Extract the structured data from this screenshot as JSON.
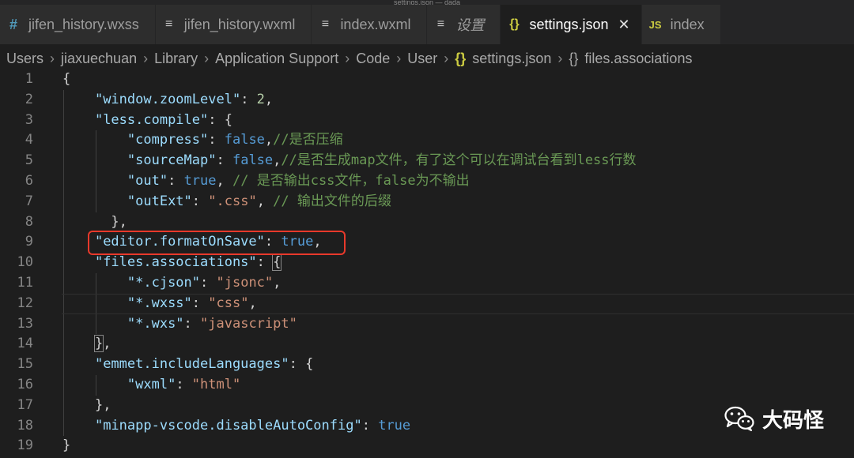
{
  "window": {
    "title": "settings.json — dada"
  },
  "tabs": [
    {
      "label": "jifen_history.wxss",
      "icon": "css-hash-icon",
      "icon_text": "#",
      "active": false,
      "italic": false
    },
    {
      "label": "jifen_history.wxml",
      "icon": "file-lines-icon",
      "icon_text": "≡",
      "active": false,
      "italic": false
    },
    {
      "label": "index.wxml",
      "icon": "file-lines-icon",
      "icon_text": "≡",
      "active": false,
      "italic": false
    },
    {
      "label": "设置",
      "icon": "file-lines-icon",
      "icon_text": "≡",
      "active": false,
      "italic": true
    },
    {
      "label": "settings.json",
      "icon": "json-braces-icon",
      "icon_text": "{}",
      "active": true,
      "italic": false,
      "close": "✕"
    },
    {
      "label": "index",
      "icon": "js-icon",
      "icon_text": "JS",
      "active": false,
      "italic": false
    }
  ],
  "breadcrumb": {
    "items": [
      "Users",
      "jiaxuechuan",
      "Library",
      "Application Support",
      "Code",
      "User"
    ],
    "file_icon": "{}",
    "file": "settings.json",
    "symbol_icon": "{}",
    "symbol": "files.associations",
    "separator": "›"
  },
  "editor": {
    "current_line": 12,
    "highlighted_line": 9,
    "lines": [
      {
        "n": "1",
        "indent": 0,
        "tokens": [
          [
            "p",
            "{"
          ]
        ]
      },
      {
        "n": "2",
        "indent": 1,
        "tokens": [
          [
            "k",
            "\"window.zoomLevel\""
          ],
          [
            "p",
            ": "
          ],
          [
            "n",
            "2"
          ],
          [
            "p",
            ","
          ]
        ]
      },
      {
        "n": "3",
        "indent": 1,
        "tokens": [
          [
            "k",
            "\"less.compile\""
          ],
          [
            "p",
            ": {"
          ]
        ]
      },
      {
        "n": "4",
        "indent": 2,
        "tokens": [
          [
            "k",
            "\"compress\""
          ],
          [
            "p",
            ": "
          ],
          [
            "b",
            "false"
          ],
          [
            "p",
            ","
          ],
          [
            "c",
            "//是否压缩"
          ]
        ]
      },
      {
        "n": "5",
        "indent": 2,
        "tokens": [
          [
            "k",
            "\"sourceMap\""
          ],
          [
            "p",
            ": "
          ],
          [
            "b",
            "false"
          ],
          [
            "p",
            ","
          ],
          [
            "c",
            "//是否生成map文件，有了这个可以在调试台看到less行数"
          ]
        ]
      },
      {
        "n": "6",
        "indent": 2,
        "tokens": [
          [
            "k",
            "\"out\""
          ],
          [
            "p",
            ": "
          ],
          [
            "b",
            "true"
          ],
          [
            "p",
            ", "
          ],
          [
            "c",
            "// 是否输出css文件，false为不输出"
          ]
        ]
      },
      {
        "n": "7",
        "indent": 2,
        "tokens": [
          [
            "k",
            "\"outExt\""
          ],
          [
            "p",
            ": "
          ],
          [
            "s",
            "\".css\""
          ],
          [
            "p",
            ", "
          ],
          [
            "c",
            "// 输出文件的后缀"
          ]
        ]
      },
      {
        "n": "8",
        "indent": 1,
        "tokens": [
          [
            "p",
            "  },"
          ]
        ]
      },
      {
        "n": "9",
        "indent": 1,
        "tokens": [
          [
            "k",
            "\"editor.formatOnSave\""
          ],
          [
            "p",
            ": "
          ],
          [
            "b",
            "true"
          ],
          [
            "p",
            ","
          ]
        ]
      },
      {
        "n": "10",
        "indent": 1,
        "tokens": [
          [
            "k",
            "\"files.associations\""
          ],
          [
            "p",
            ": "
          ],
          [
            "pb",
            "{"
          ]
        ]
      },
      {
        "n": "11",
        "indent": 2,
        "tokens": [
          [
            "k",
            "\"*.cjson\""
          ],
          [
            "p",
            ": "
          ],
          [
            "s",
            "\"jsonc\""
          ],
          [
            "p",
            ","
          ]
        ]
      },
      {
        "n": "12",
        "indent": 2,
        "tokens": [
          [
            "k",
            "\"*.wxss\""
          ],
          [
            "p",
            ": "
          ],
          [
            "s",
            "\"css\""
          ],
          [
            "p",
            ","
          ]
        ]
      },
      {
        "n": "13",
        "indent": 2,
        "tokens": [
          [
            "k",
            "\"*.wxs\""
          ],
          [
            "p",
            ": "
          ],
          [
            "s",
            "\"javascript\""
          ]
        ]
      },
      {
        "n": "14",
        "indent": 1,
        "tokens": [
          [
            "pb",
            "}"
          ],
          [
            "p",
            ","
          ]
        ]
      },
      {
        "n": "15",
        "indent": 1,
        "tokens": [
          [
            "k",
            "\"emmet.includeLanguages\""
          ],
          [
            "p",
            ": {"
          ]
        ]
      },
      {
        "n": "16",
        "indent": 2,
        "tokens": [
          [
            "k",
            "\"wxml\""
          ],
          [
            "p",
            ": "
          ],
          [
            "s",
            "\"html\""
          ]
        ]
      },
      {
        "n": "17",
        "indent": 1,
        "tokens": [
          [
            "p",
            "},"
          ]
        ]
      },
      {
        "n": "18",
        "indent": 1,
        "tokens": [
          [
            "k",
            "\"minapp-vscode.disableAutoConfig\""
          ],
          [
            "p",
            ": "
          ],
          [
            "b",
            "true"
          ]
        ]
      },
      {
        "n": "19",
        "indent": 0,
        "tokens": [
          [
            "p",
            "}"
          ]
        ]
      }
    ]
  },
  "watermark": {
    "text": "大码怪",
    "icon": "wechat-icon"
  },
  "colors": {
    "background": "#1e1e1e",
    "key": "#9cdcfe",
    "string": "#ce9178",
    "number": "#b5cea8",
    "boolean": "#569cd6",
    "comment": "#6a9955",
    "highlight_border": "#e8392b"
  }
}
